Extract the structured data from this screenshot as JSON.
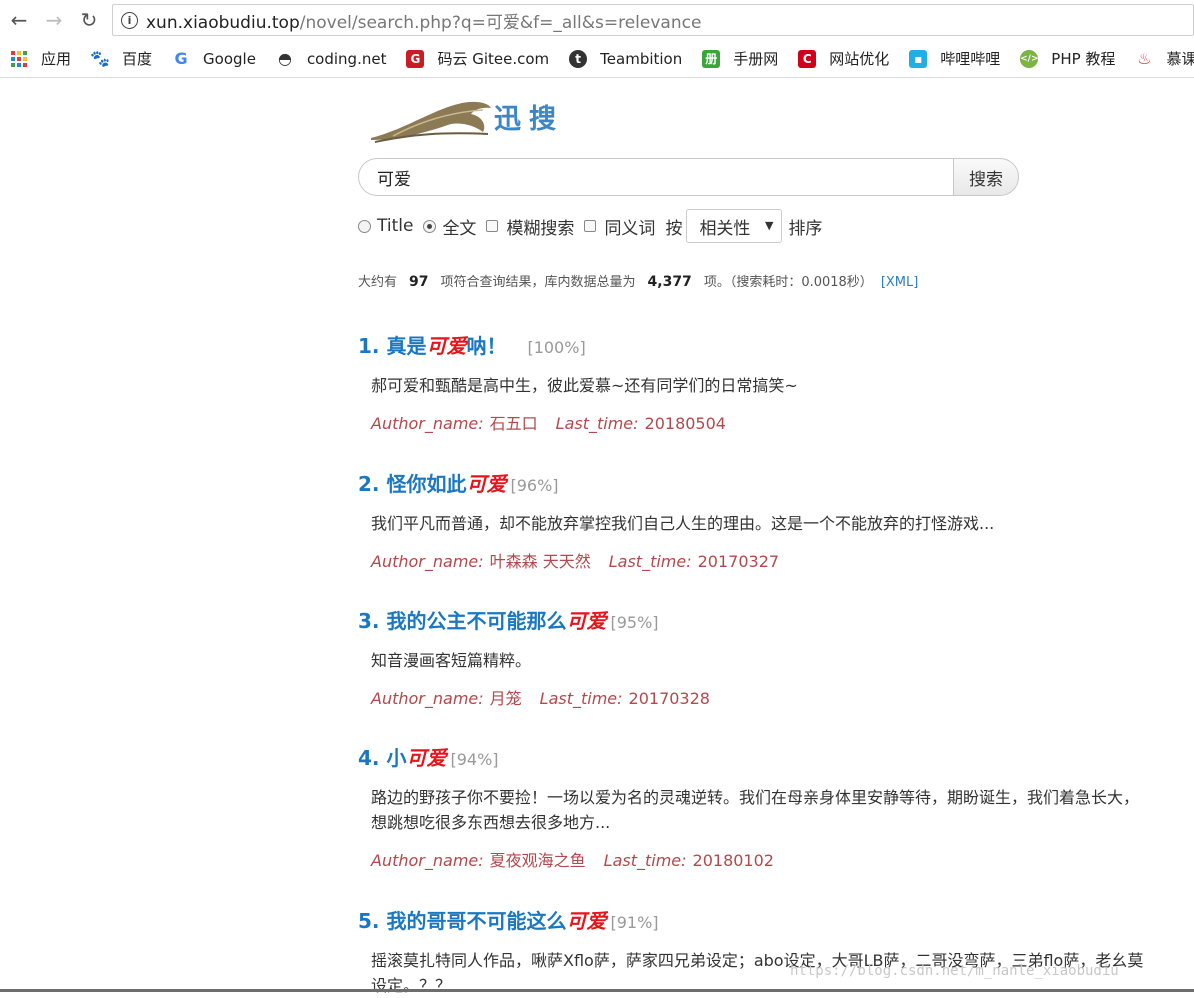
{
  "browser": {
    "url_host": "xun.xiaobudiu.top",
    "url_rest": "/novel/search.php?q=可爱&f=_all&s=relevance",
    "bookmarks": [
      {
        "label": "应用",
        "icon": "apps-grid-icon"
      },
      {
        "label": "百度",
        "icon": "baidu-paw-icon"
      },
      {
        "label": "Google",
        "icon": "google-g-icon"
      },
      {
        "label": "coding.net",
        "icon": "coding-icon"
      },
      {
        "label": "码云 Gitee.com",
        "icon": "gitee-icon"
      },
      {
        "label": "Teambition",
        "icon": "teambition-icon"
      },
      {
        "label": "手册网",
        "icon": "shouce-icon"
      },
      {
        "label": "网站优化",
        "icon": "seo-icon"
      },
      {
        "label": "哔哩哔哩",
        "icon": "bilibili-icon"
      },
      {
        "label": "PHP 教程",
        "icon": "php-icon"
      },
      {
        "label": "慕课网",
        "icon": "imooc-icon"
      }
    ]
  },
  "site": {
    "logo_text": "迅搜"
  },
  "search": {
    "query": "可爱",
    "button": "搜索"
  },
  "options": {
    "title": "Title",
    "fulltext": "全文",
    "fuzzy": "模糊搜索",
    "synonym": "同义词",
    "by": "按",
    "sort_value": "相关性",
    "sort_suffix": "排序"
  },
  "stats": {
    "prefix": "大约有",
    "count": "97",
    "mid": "项符合查询结果，库内数据总量为",
    "total": "4,377",
    "suffix": "项。（搜索耗时：0.0018秒）",
    "xml": "[XML]"
  },
  "labels": {
    "author": "Author_name:",
    "time": "Last_time:"
  },
  "results": [
    {
      "num": "1.",
      "pre": "真是",
      "hl": "可爱",
      "post": "呐！",
      "score": "[100%]",
      "desc": "郝可爱和甄酷是高中生，彼此爱慕~还有同学们的日常搞笑~",
      "author": "石五口",
      "time": "20180504"
    },
    {
      "num": "2.",
      "pre": "怪你如此",
      "hl": "可爱",
      "post": "",
      "score": "[96%]",
      "desc": "我们平凡而普通，却不能放弃掌控我们自己人生的理由。这是一个不能放弃的打怪游戏...",
      "author": "叶森森 天天然",
      "time": "20170327"
    },
    {
      "num": "3.",
      "pre": "我的公主不可能那么",
      "hl": "可爱",
      "post": "",
      "score": "[95%]",
      "desc": "知音漫画客短篇精粹。",
      "author": "月笼",
      "time": "20170328"
    },
    {
      "num": "4.",
      "pre": "小",
      "hl": "可爱",
      "post": "",
      "score": "[94%]",
      "desc": "路边的野孩子你不要捡！一场以爱为名的灵魂逆转。我们在母亲身体里安静等待，期盼诞生，我们着急长大，\n想跳想吃很多东西想去很多地方...",
      "author": "夏夜观海之鱼",
      "time": "20180102"
    },
    {
      "num": "5.",
      "pre": "我的哥哥不可能这么",
      "hl": "可爱",
      "post": "",
      "score": "[91%]",
      "desc": "摇滚莫扎特同人作品，啾萨Xflo萨，萨家四兄弟设定；abo设定，大哥LB萨，二哥没弯萨，三弟flo萨，老幺莫\n设定。？？",
      "author": "",
      "time": ""
    }
  ],
  "watermark": "https://blog.csdn.net/m_nanle_xiaobudiu"
}
